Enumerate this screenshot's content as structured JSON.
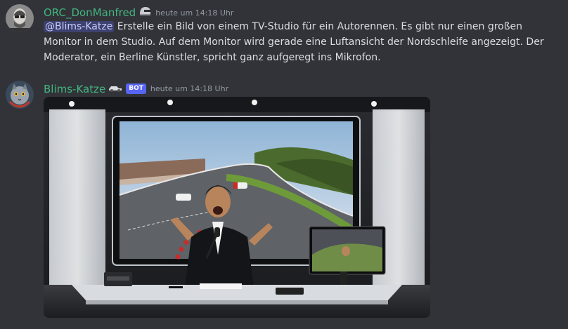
{
  "messages": [
    {
      "username": "ORC_DonManfred",
      "username_color": "#43b581",
      "timestamp": "heute um 14:18 Uhr",
      "mention": "@Blims-Katze",
      "text": "Erstelle ein Bild von einem TV-Studio für ein Autorennen. Es gibt nur einen großen Monitor in dem Studio. Auf dem Monitor wird gerade eine Luftansicht der Nordschleife angezeigt. Der Moderator, ein Berline Künstler, spricht ganz aufgeregt ins Mikrofon.",
      "decoration_icon": "helmet-icon"
    },
    {
      "username": "Blims-Katze",
      "username_color": "#43b581",
      "bot_tag": "BOT",
      "timestamp": "heute um 14:18 Uhr",
      "decoration_icon": "racecar-icon",
      "attachment": "generated-image"
    }
  ]
}
